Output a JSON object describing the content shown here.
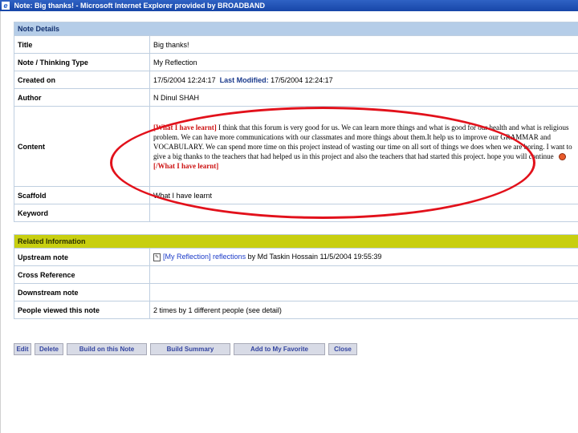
{
  "window": {
    "title": "Note: Big thanks! - Microsoft Internet Explorer provided by BROADBAND"
  },
  "note_details": {
    "header": "Note Details",
    "rows": {
      "title": {
        "label": "Title",
        "value": "Big thanks!"
      },
      "thinking_type": {
        "label": "Note / Thinking Type",
        "value": "My Reflection"
      },
      "created_on": {
        "label": "Created on",
        "created": "17/5/2004 12:24:17",
        "modified_label": "Last Modified:",
        "modified": "17/5/2004 12:24:17"
      },
      "author": {
        "label": "Author",
        "value": "N Dinul SHAH"
      },
      "content": {
        "label": "Content",
        "open_tag": "[What I have learnt]",
        "text": "I think that this forum is very good for us. We can learn more things and what is good for our health and what is religious problem. We can have more communications with our classmates and more things about them.It help us to improve our GRAMMAR and VOCABULARY. We can spend more time on this project instead of wasting our time on all sort of things we does when we are boring. I want to give a big thanks to the teachers that had helped us in this project and also the teachers that had started this project. hope you will continue",
        "close_tag": "[/What I have learnt]"
      },
      "scaffold": {
        "label": "Scaffold",
        "value": "What I have learnt"
      },
      "keyword": {
        "label": "Keyword",
        "value": ""
      }
    }
  },
  "related_info": {
    "header": "Related Information",
    "rows": {
      "upstream": {
        "label": "Upstream note",
        "tag": "[My Reflection]",
        "link": "reflections",
        "by_text": "by Md Taskin Hossain 11/5/2004 19:55:39"
      },
      "cross_reference": {
        "label": "Cross Reference",
        "value": ""
      },
      "downstream": {
        "label": "Downstream note",
        "value": ""
      },
      "viewed": {
        "label": "People viewed this note",
        "value": "2 times by 1 different people (see detail)"
      }
    }
  },
  "buttons": {
    "edit": "Edit",
    "delete": "Delete",
    "build_on": "Build on this Note",
    "build_summary": "Build Summary",
    "add_favorite": "Add to My Favorite",
    "close": "Close"
  },
  "colors": {
    "note_header": "#b5cde8",
    "related_header": "#c8cf10",
    "annotation_oval": "#e2111b",
    "tag_red": "#cc1111"
  }
}
